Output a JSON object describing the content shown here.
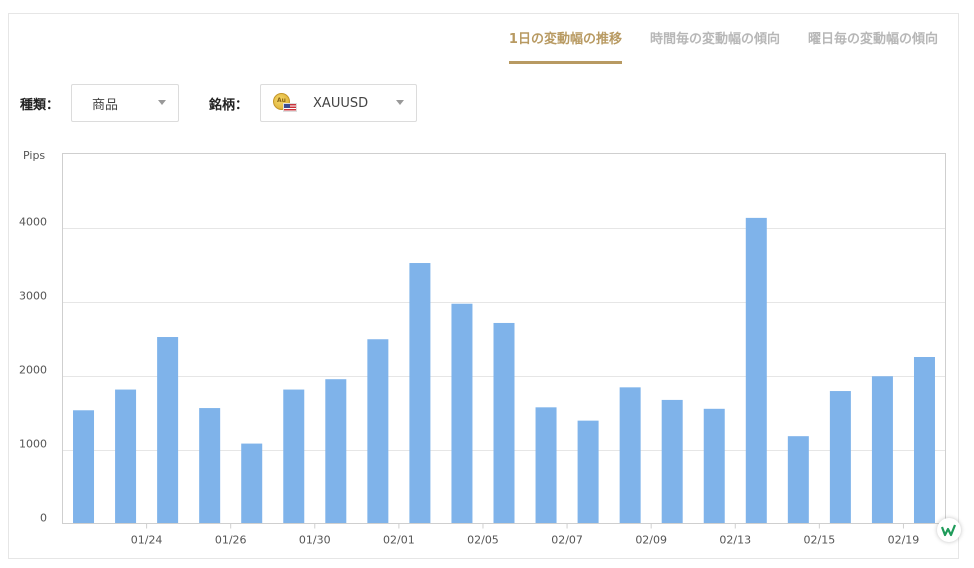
{
  "tabs": [
    {
      "label": "1日の変動幅の推移",
      "active": true
    },
    {
      "label": "時間毎の変動幅の傾向",
      "active": false
    },
    {
      "label": "曜日毎の変動幅の傾向",
      "active": false
    }
  ],
  "filters": {
    "type_label": "種類：",
    "type_value": "商品",
    "symbol_label": "銘柄：",
    "symbol_value": "XAUUSD",
    "symbol_icon": "gold-coin-us-flag-icon"
  },
  "colors": {
    "accent": "#b89a62",
    "bar": "#7fb3ea",
    "grid": "#e6e6e6"
  },
  "chart_data": {
    "type": "bar",
    "ylabel": "Pips",
    "ylim": [
      0,
      5000
    ],
    "yticks": [
      0,
      1000,
      2000,
      3000,
      4000
    ],
    "grid": true,
    "xtick_labels": [
      "01/24",
      "01/26",
      "01/30",
      "02/01",
      "02/05",
      "02/07",
      "02/09",
      "02/13",
      "02/15",
      "02/19"
    ],
    "xtick_after_bar": [
      2,
      4,
      6,
      8,
      10,
      12,
      14,
      16,
      18,
      20
    ],
    "values": [
      1530,
      1810,
      2520,
      1560,
      1080,
      1810,
      1950,
      2490,
      3520,
      2970,
      2710,
      1570,
      1390,
      1840,
      1670,
      1550,
      4130,
      1180,
      1790,
      1990,
      2250
    ]
  }
}
